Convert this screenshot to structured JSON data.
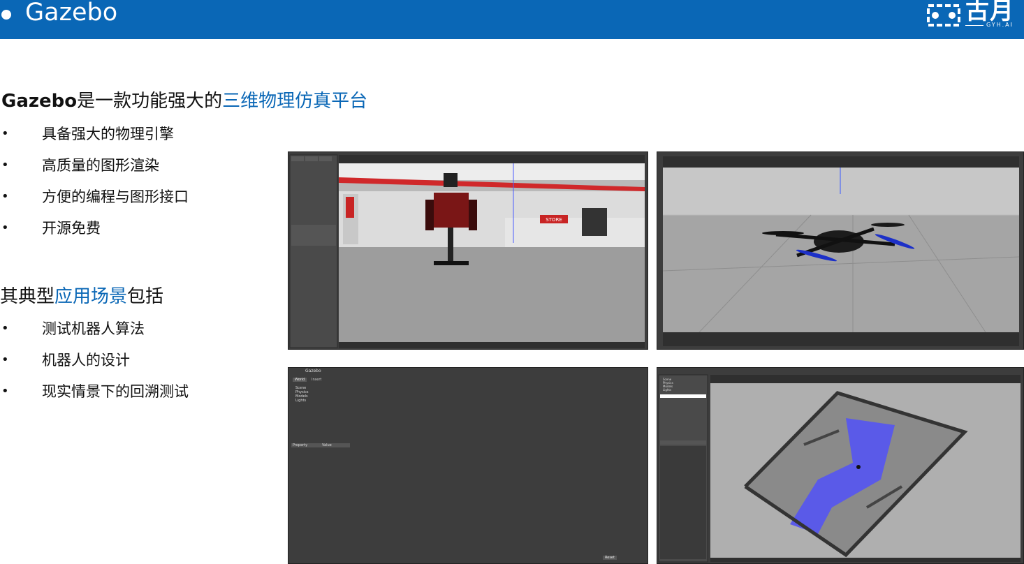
{
  "header": {
    "title": "Gazebo",
    "logo_brand": "古月",
    "logo_sub": "GYH.AI"
  },
  "section1": {
    "title_prefix": "Gazebo",
    "title_mid": "是一款功能强大的",
    "title_highlight": "三维物理仿真平台",
    "bullets": [
      "具备强大的物理引擎",
      "高质量的图形渲染",
      "方便的编程与图形接口",
      "开源免费"
    ]
  },
  "section2": {
    "title_prefix": "其典型",
    "title_highlight": "应用场景",
    "title_suffix": "包括",
    "bullets": [
      "测试机器人算法",
      "机器人的设计",
      "现实情景下的回溯测试"
    ]
  },
  "screens": {
    "s1": {
      "sign": "STORE"
    },
    "s3": {
      "window_title": "Gazebo",
      "tab_world": "World",
      "tab_insert": "Insert",
      "tree": [
        "Scene",
        "Physics",
        "Models",
        "Lights"
      ],
      "prop_header": "Property",
      "value_header": "Value",
      "reset": "Reset"
    },
    "s4": {
      "tree": [
        "Scene",
        "Physics",
        "Models",
        "Lights"
      ]
    }
  },
  "colors": {
    "brand_blue": "#0a67b6",
    "gazebo_panel": "#3d3d3d",
    "ground": "#9a9a9a"
  }
}
